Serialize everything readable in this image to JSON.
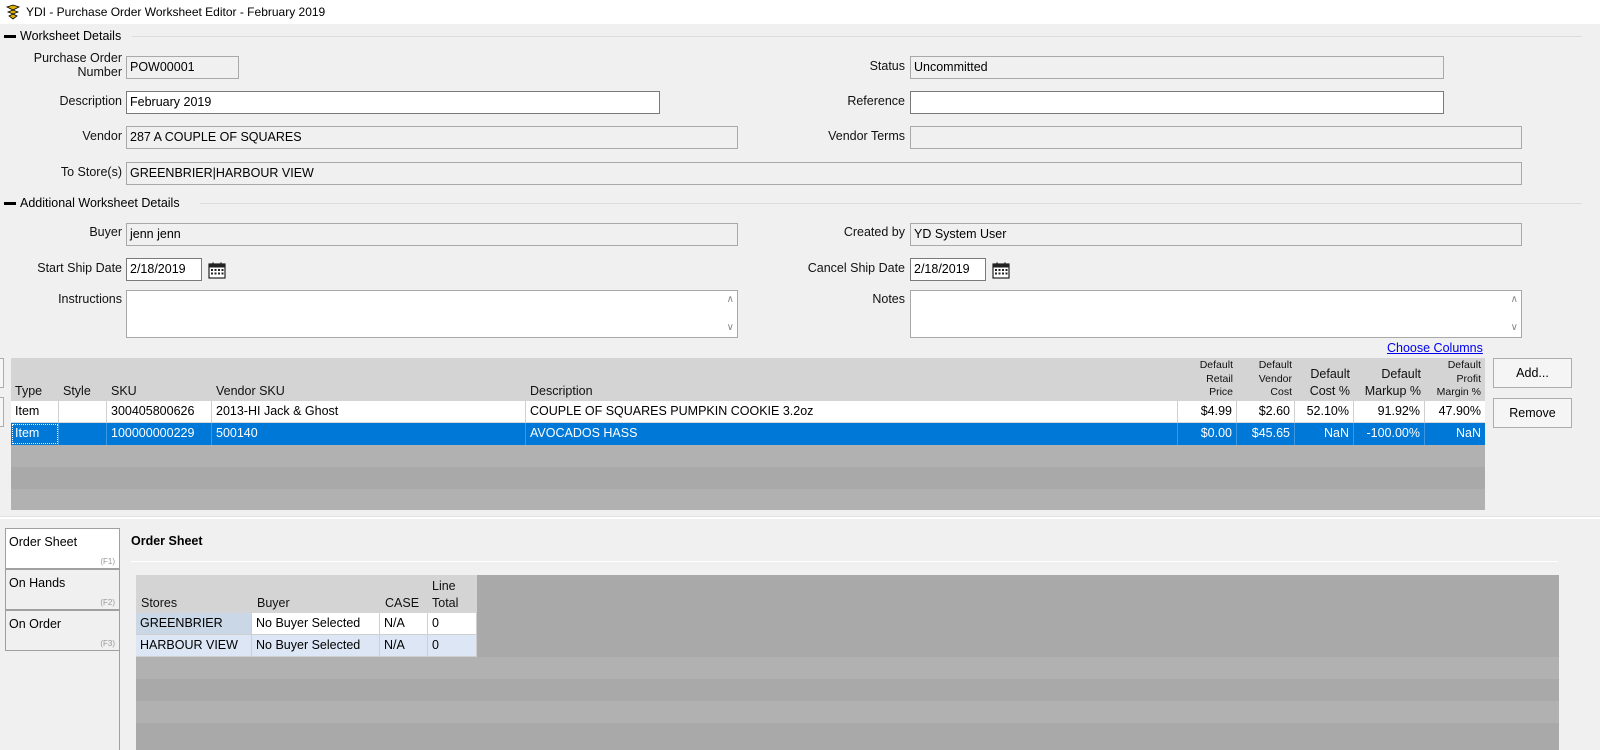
{
  "window": {
    "title": "YDI - Purchase Order Worksheet Editor - February 2019"
  },
  "worksheet": {
    "section_title": "Worksheet Details",
    "po_number_label": "Purchase Order Number",
    "po_number": "POW00001",
    "status_label": "Status",
    "status": "Uncommitted",
    "description_label": "Description",
    "description": "February 2019",
    "reference_label": "Reference",
    "reference": "",
    "vendor_label": "Vendor",
    "vendor": "287 A COUPLE OF SQUARES",
    "vendor_terms_label": "Vendor Terms",
    "vendor_terms": "",
    "to_stores_label": "To Store(s)",
    "to_stores": "GREENBRIER|HARBOUR VIEW"
  },
  "additional": {
    "section_title": "Additional Worksheet Details",
    "buyer_label": "Buyer",
    "buyer": "jenn jenn",
    "created_by_label": "Created by",
    "created_by": "YD System User",
    "start_ship_label": "Start Ship Date",
    "start_ship": "2/18/2019",
    "cancel_ship_label": "Cancel Ship Date",
    "cancel_ship": "2/18/2019",
    "instructions_label": "Instructions",
    "instructions": "",
    "notes_label": "Notes",
    "notes": ""
  },
  "items": {
    "choose_columns": "Choose Columns",
    "add_button": "Add...",
    "remove_button": "Remove",
    "columns": {
      "type": "Type",
      "style": "Style",
      "sku": "SKU",
      "vendor_sku": "Vendor SKU",
      "description": "Description",
      "retail_l1": "Default",
      "retail_l2": "Retail",
      "retail_l3": "Price",
      "vcost_l1": "Default",
      "vcost_l2": "Vendor",
      "vcost_l3": "Cost",
      "cost_l1": "Default",
      "cost_l2": "Cost %",
      "markup_l1": "Default",
      "markup_l2": "Markup %",
      "margin_l1": "Default",
      "margin_l2": "Profit",
      "margin_l3": "Margin %"
    },
    "rows": [
      {
        "type": "Item",
        "style": "",
        "sku": "300405800626",
        "vendor_sku": "2013-HI Jack & Ghost",
        "description": "COUPLE OF SQUARES PUMPKIN COOKIE 3.2oz",
        "retail": "$4.99",
        "vendor_cost": "$2.60",
        "cost_pct": "52.10%",
        "markup_pct": "91.92%",
        "margin_pct": "47.90%"
      },
      {
        "type": "Item",
        "style": "",
        "sku": "100000000229",
        "vendor_sku": "500140",
        "description": "AVOCADOS HASS",
        "retail": "$0.00",
        "vendor_cost": "$45.65",
        "cost_pct": "NaN",
        "markup_pct": "-100.00%",
        "margin_pct": "NaN"
      }
    ]
  },
  "tabs": [
    {
      "label": "Order Sheet",
      "key": "(F1)"
    },
    {
      "label": "On Hands",
      "key": "(F2)"
    },
    {
      "label": "On Order",
      "key": "(F3)"
    }
  ],
  "order_sheet": {
    "title": "Order Sheet",
    "columns": {
      "stores": "Stores",
      "buyer": "Buyer",
      "case": "CASE",
      "line_total_l1": "Line",
      "line_total_l2": "Total"
    },
    "rows": [
      {
        "store": "GREENBRIER",
        "buyer": "No Buyer Selected",
        "case": "N/A",
        "total": "0"
      },
      {
        "store": "HARBOUR VIEW",
        "buyer": "No Buyer Selected",
        "case": "N/A",
        "total": "0"
      }
    ]
  },
  "colors": {
    "selection": "#0078d7",
    "link": "#0000ee",
    "grid_empty": "#a9a9a9"
  }
}
